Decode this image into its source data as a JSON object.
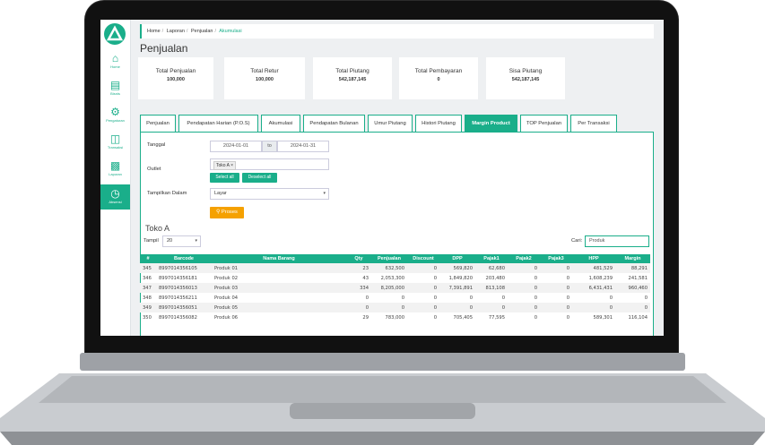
{
  "breadcrumb": [
    "Home",
    "Laporan",
    "Penjualan",
    "Akumulasi"
  ],
  "page_title": "Penjualan",
  "stats": [
    {
      "label": "Total Penjualan",
      "value": "100,000"
    },
    {
      "label": "Total Retur",
      "value": "100,000"
    },
    {
      "label": "Total Piutang",
      "value": "542,187,145"
    },
    {
      "label": "Total Pembayaran",
      "value": "0"
    },
    {
      "label": "Sisa Piutang",
      "value": "542,187,145"
    }
  ],
  "sidebar": [
    {
      "label": "Home",
      "icon": "home-icon"
    },
    {
      "label": "Bisnis",
      "icon": "card-icon"
    },
    {
      "label": "Pengaturan",
      "icon": "gear-icon"
    },
    {
      "label": "Transaksi",
      "icon": "basket-icon"
    },
    {
      "label": "Laporan",
      "icon": "bar-chart-icon"
    },
    {
      "label": "Absensi",
      "icon": "clock-icon"
    }
  ],
  "tabs": [
    "Penjualan",
    "Pendapatan Harian (P.O.S)",
    "Akumulasi",
    "Pendapatan Bulanan",
    "Umur Piutang",
    "Histori Piutang",
    "Margin Product",
    "TOP Penjualan",
    "Per Transaksi"
  ],
  "active_tab": "Margin Product",
  "filters": {
    "tanggal_label": "Tanggal",
    "date_from": "2024-01-01",
    "date_to_sep": "to",
    "date_to": "2024-01-31",
    "outlet_label": "Outlet",
    "outlet_chip": "Toko A ×",
    "select_all": "Select all",
    "deselect_all": "Deselect all",
    "tampilkan_label": "Tampilkan Dalam",
    "tampilkan_value": "Layar",
    "proses": "Proses"
  },
  "table": {
    "title": "Toko A",
    "show_label": "Tampil",
    "show_value": "20",
    "search_label": "Cari:",
    "search_value": "Produk",
    "headers": [
      "#",
      "Barcode",
      "Nama Barang",
      "Qty",
      "Penjualan",
      "Discount",
      "DPP",
      "Pajak1",
      "Pajak2",
      "Pajak3",
      "HPP",
      "Margin"
    ],
    "rows": [
      [
        "345",
        "8997014356105",
        "Produk 01",
        "23",
        "632,500",
        "0",
        "569,820",
        "62,680",
        "0",
        "0",
        "481,529",
        "88,291"
      ],
      [
        "346",
        "8997014356181",
        "Produk 02",
        "43",
        "2,053,300",
        "0",
        "1,849,820",
        "203,480",
        "0",
        "0",
        "1,608,239",
        "241,581"
      ],
      [
        "347",
        "8997014356013",
        "Produk 03",
        "334",
        "8,205,000",
        "0",
        "7,391,891",
        "813,108",
        "0",
        "0",
        "6,431,431",
        "960,460"
      ],
      [
        "348",
        "8997014356211",
        "Produk 04",
        "0",
        "0",
        "0",
        "0",
        "0",
        "0",
        "0",
        "0",
        "0"
      ],
      [
        "349",
        "8997014356051",
        "Produk 05",
        "0",
        "0",
        "0",
        "0",
        "0",
        "0",
        "0",
        "0",
        "0"
      ],
      [
        "350",
        "8997014356082",
        "Produk 06",
        "29",
        "783,000",
        "0",
        "705,405",
        "77,595",
        "0",
        "0",
        "589,301",
        "116,104"
      ]
    ]
  }
}
